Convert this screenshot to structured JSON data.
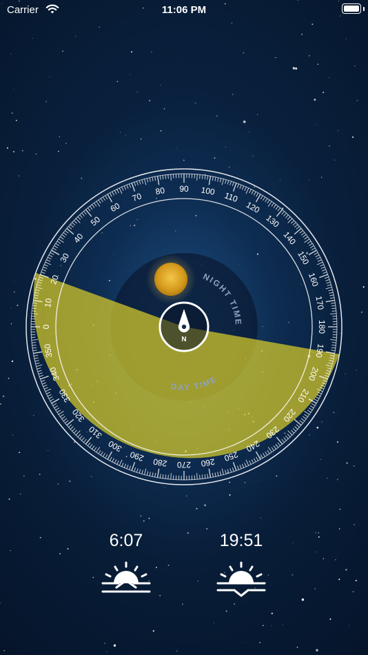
{
  "status_bar": {
    "carrier": "Carrier",
    "time": "11:06 PM"
  },
  "compass": {
    "night_label": "NIGHT TIME",
    "day_label": "DAY TIME",
    "north_label": "N",
    "degree_labels": [
      "0",
      "10",
      "20",
      "30",
      "40",
      "50",
      "60",
      "70",
      "80",
      "90",
      "100",
      "110",
      "120",
      "130",
      "140",
      "150",
      "160",
      "170",
      "180",
      "190",
      "200",
      "210",
      "220",
      "230",
      "240",
      "250",
      "260",
      "270",
      "280",
      "290",
      "300",
      "310",
      "320",
      "330",
      "340",
      "350"
    ],
    "daylight_band_color": "#d8cc2a"
  },
  "sun_times": {
    "sunrise": "6:07",
    "sunset": "19:51"
  },
  "icons": {
    "sunrise": "sunrise-icon",
    "sunset": "sunset-icon",
    "compass": "compass-needle-icon",
    "sun": "sun-icon"
  }
}
